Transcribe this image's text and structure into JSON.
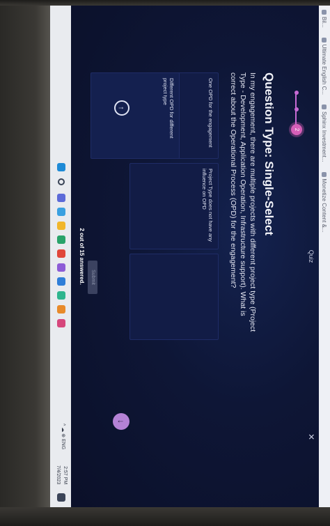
{
  "favorites": [
    {
      "label": "Bil..."
    },
    {
      "label": "Ultimate English C..."
    },
    {
      "label": "Sphinx Investment..."
    },
    {
      "label": "Monetize Content &..."
    }
  ],
  "quiz": {
    "title": "Quiz",
    "close_label": "✕",
    "stepper_current": 2,
    "question_type": "Question Type: Single-Select",
    "question_text": "In my engagement, there are multiple projects with different project type (Project Type - Development, Application Operation, Infrastructure support). What is correct about the Operational Process (OPD) for the engagement?",
    "options": [
      "One OPD for the engagement",
      "Project Type does not have any influence on OPD",
      "",
      "Different OPD for different project type"
    ],
    "prev_label": "↑",
    "next_label": "↓",
    "progress_text": "2 out of 15 answered.",
    "submit_label": "Submit"
  },
  "taskbar": {
    "tray_text": "^ ☁ ⊕ ENG",
    "time": "2:57 PM",
    "date": "7/4/2023"
  },
  "colors": {
    "accent": "#d65fb8",
    "next_button": "#b582d6",
    "app_bg": "#0e1636"
  }
}
